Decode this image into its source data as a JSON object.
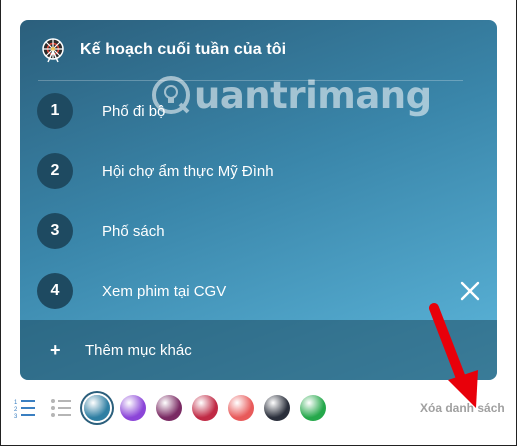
{
  "card": {
    "title": "Kế hoạch cuối tuần của tôi",
    "watermark": "uantrimang",
    "items": [
      {
        "number": "1",
        "label": "Phố đi bộ"
      },
      {
        "number": "2",
        "label": "Hội chợ ẩm thực Mỹ Đình"
      },
      {
        "number": "3",
        "label": "Phố sách"
      },
      {
        "number": "4",
        "label": "Xem phim tại CGV"
      }
    ],
    "add_label": "Thêm mục khác"
  },
  "toolbar": {
    "clear_label": "Xóa danh sách",
    "colors": [
      {
        "name": "teal",
        "hex": "#2f7fa3",
        "selected": true
      },
      {
        "name": "purple",
        "hex": "#8b45d8"
      },
      {
        "name": "plum",
        "hex": "#7a2a63"
      },
      {
        "name": "crimson",
        "hex": "#c02a45"
      },
      {
        "name": "coral",
        "hex": "#e85a5a"
      },
      {
        "name": "charcoal",
        "hex": "#2a2f3b"
      },
      {
        "name": "green",
        "hex": "#25a84b"
      }
    ],
    "icons": [
      "numbered-list-icon",
      "bullet-list-icon"
    ]
  },
  "annotation_color": "#e8000a"
}
